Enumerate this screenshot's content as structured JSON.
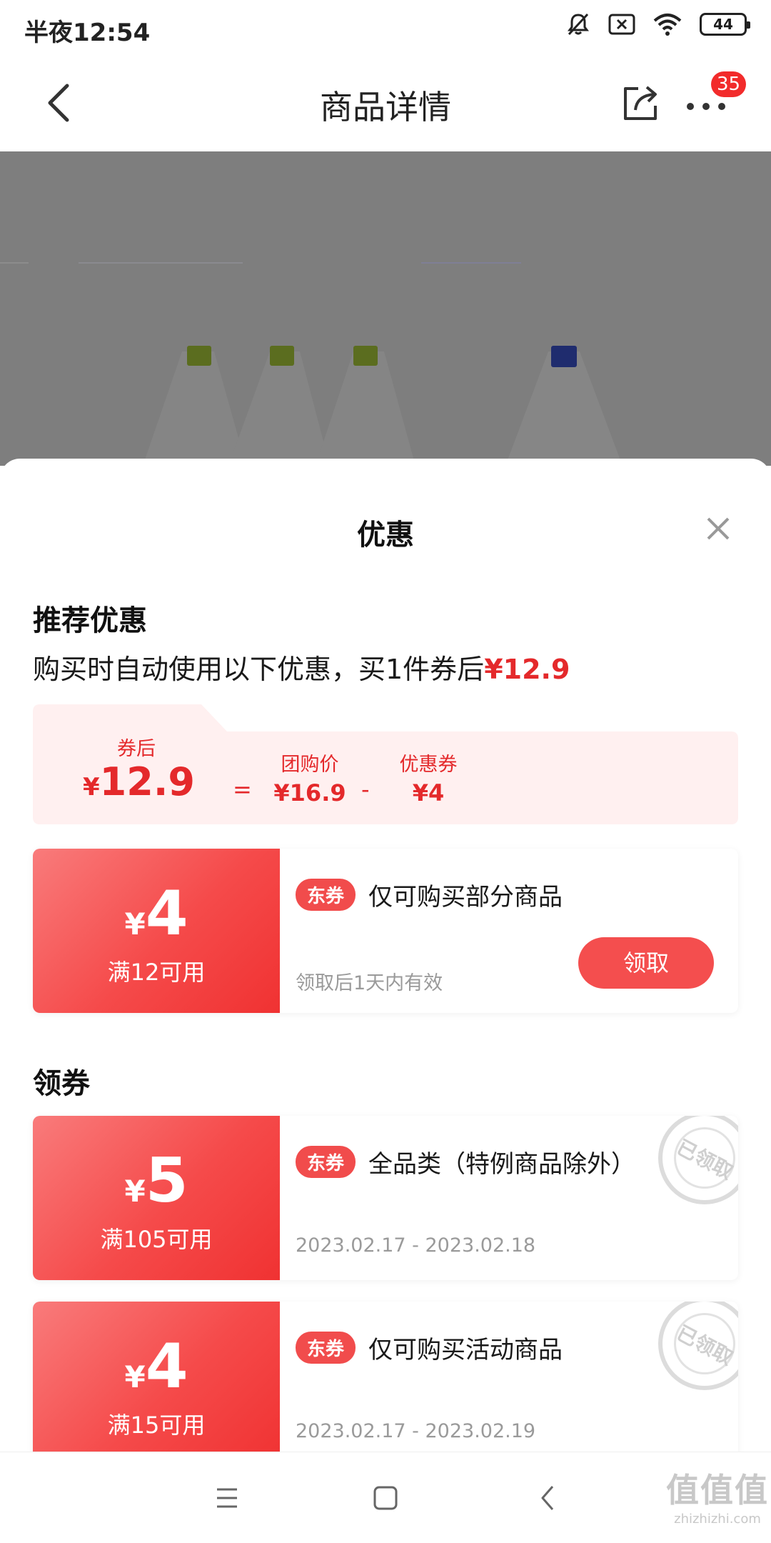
{
  "status_bar": {
    "time": "半夜12:54",
    "battery": "44"
  },
  "header": {
    "title": "商品详情",
    "badge": "35"
  },
  "sheet": {
    "title": "优惠",
    "recommend": {
      "title": "推荐优惠",
      "desc_prefix": "购买时自动使用以下优惠，买1件券后",
      "desc_price": "¥12.9",
      "after_label": "券后",
      "after_yen": "¥",
      "after_value": "12.9",
      "equals": "=",
      "group_label": "团购价",
      "group_value": "¥16.9",
      "minus": "-",
      "coupon_label": "优惠券",
      "coupon_value": "¥4"
    },
    "recommend_coupon": {
      "yen": "¥",
      "amount": "4",
      "condition": "满12可用",
      "tag": "东券",
      "desc": "仅可购买部分商品",
      "sub": "领取后1天内有效",
      "button": "领取"
    },
    "collect_title": "领券",
    "coupons": [
      {
        "yen": "¥",
        "amount": "5",
        "condition": "满105可用",
        "tag": "东券",
        "desc": "全品类（特例商品除外）",
        "date": "2023.02.17 - 2023.02.18",
        "stamp": "已领取"
      },
      {
        "yen": "¥",
        "amount": "4",
        "condition": "满15可用",
        "tag": "东券",
        "desc": "仅可购买活动商品",
        "date": "2023.02.17 - 2023.02.19",
        "stamp": "已领取"
      }
    ]
  },
  "watermark": {
    "big": "值值值",
    "small": "zhizhizhi.com"
  },
  "colors": {
    "accent_red": "#e4292b",
    "coupon_red": "#f44e4e",
    "badge_red": "#f22b2b",
    "sheet_tint": "#fff0f0"
  },
  "icons": [
    "back-arrow-icon",
    "share-icon",
    "more-icon",
    "close-icon",
    "mute-icon",
    "sim-off-icon",
    "wifi-icon",
    "battery-icon",
    "menu-icon",
    "home-icon",
    "back-nav-icon"
  ]
}
